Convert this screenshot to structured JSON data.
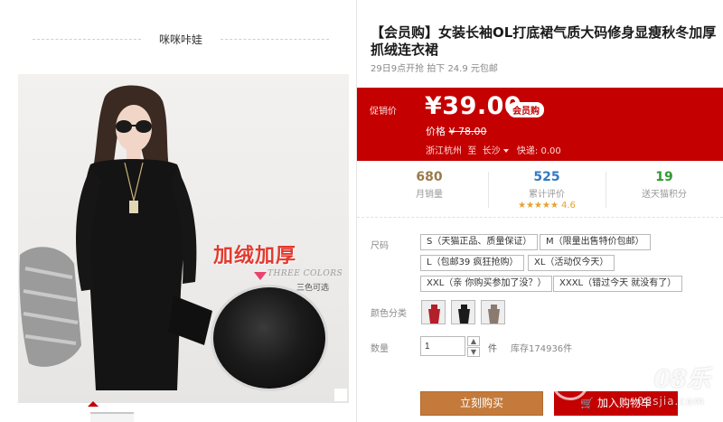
{
  "shop": {
    "name": "咪咪咔娃"
  },
  "product": {
    "title": "【会员购】女装长袖OL打底裙气质大码修身显瘦秋冬加厚抓绒连衣裙",
    "subtitle": "29日9点开抢 拍下 24.9 元包邮",
    "image_promo": "加绒加厚",
    "image_colors_en": "THREE COLORS",
    "image_colors_cn": "三色可选"
  },
  "price_panel": {
    "label": "促销价",
    "price": "¥39.00",
    "badge": "会员购",
    "orig_label": "价格",
    "orig_price": "¥ 78.00",
    "origin": "浙江杭州",
    "to": "至",
    "destination": "长沙",
    "delivery": "快递: 0.00"
  },
  "stats": [
    {
      "value": "680",
      "label": "月销量",
      "color": "#9a7a4a"
    },
    {
      "value": "525",
      "label": "累计评价",
      "color": "#2f7ac2",
      "stars": "★★★★★",
      "score": "4.6"
    },
    {
      "value": "19",
      "label": "送天猫积分",
      "color": "#2f9a2f"
    }
  ],
  "sku": {
    "size_label": "尺码",
    "sizes": [
      "S（天猫正品、质量保证）",
      "M（限量出售特价包邮）",
      "L（包邮39 疯狂抢购）",
      "XL（活动仅今天）",
      "XXL（亲 你购买参加了没？）",
      "XXXL（错过今天 就没有了）"
    ],
    "color_label": "颜色分类",
    "quantity_label": "数量",
    "quantity": "1",
    "unit": "件",
    "stock": "库存174936件"
  },
  "actions": {
    "buy_now": "立刻购买",
    "add_to_cart": "加入购物车"
  },
  "watermark": {
    "big": "08乐",
    "small": "08sjia.com"
  },
  "colors": {
    "brand_red": "#c40000",
    "buy_orange": "#c47a3a"
  }
}
